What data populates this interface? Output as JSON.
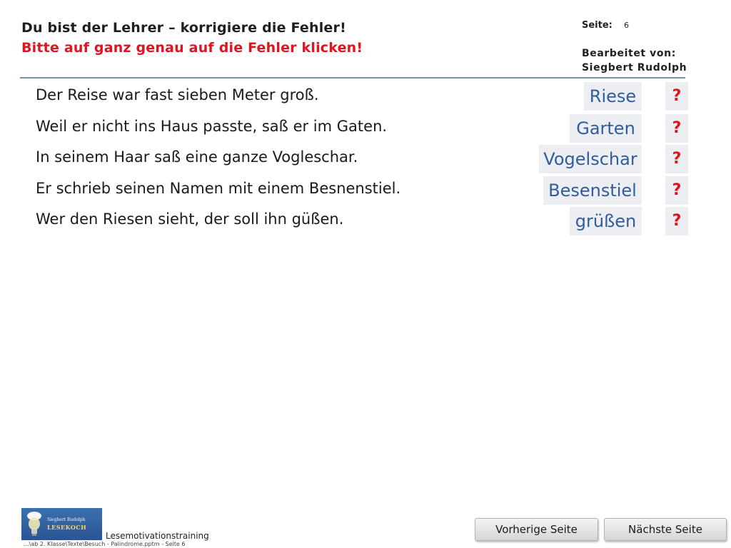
{
  "header": {
    "title": "Du bist der Lehrer – korrigiere die Fehler!",
    "subtitle": "Bitte auf ganz genau auf die Fehler klicken!",
    "page_label": "Seite:",
    "page_number": "6",
    "edited_label": "Bearbeitet von:",
    "author": "Siegbert Rudolph"
  },
  "exercise": {
    "sentences": [
      "Der Reise war fast sieben Meter groß.",
      "Weil er nicht ins Haus passte, saß er im Gaten.",
      "In seinem Haar saß eine ganze Vogleschar.",
      "Er schrieb seinen Namen mit einem Besnenstiel.",
      "Wer den Riesen sieht, der soll ihn güßen."
    ],
    "answers": [
      "Riese",
      "Garten",
      "Vogelschar",
      "Besenstiel",
      "grüßen"
    ],
    "hint_label": "?"
  },
  "footer": {
    "logo_name": "Siegbert Rudolph",
    "logo_brand": "LESEKOCH",
    "product": "Lesemotivationstraining",
    "path": "...\\ab 2. Klasse\\Texte\\Besuch - Palindrome.pptm - Seite 6",
    "prev_button": "Vorherige Seite",
    "next_button": "Nächste Seite"
  },
  "colors": {
    "title_red": "#e0141e",
    "answer_blue": "#2f5d9e",
    "rule_blue": "#6f8fc0"
  }
}
